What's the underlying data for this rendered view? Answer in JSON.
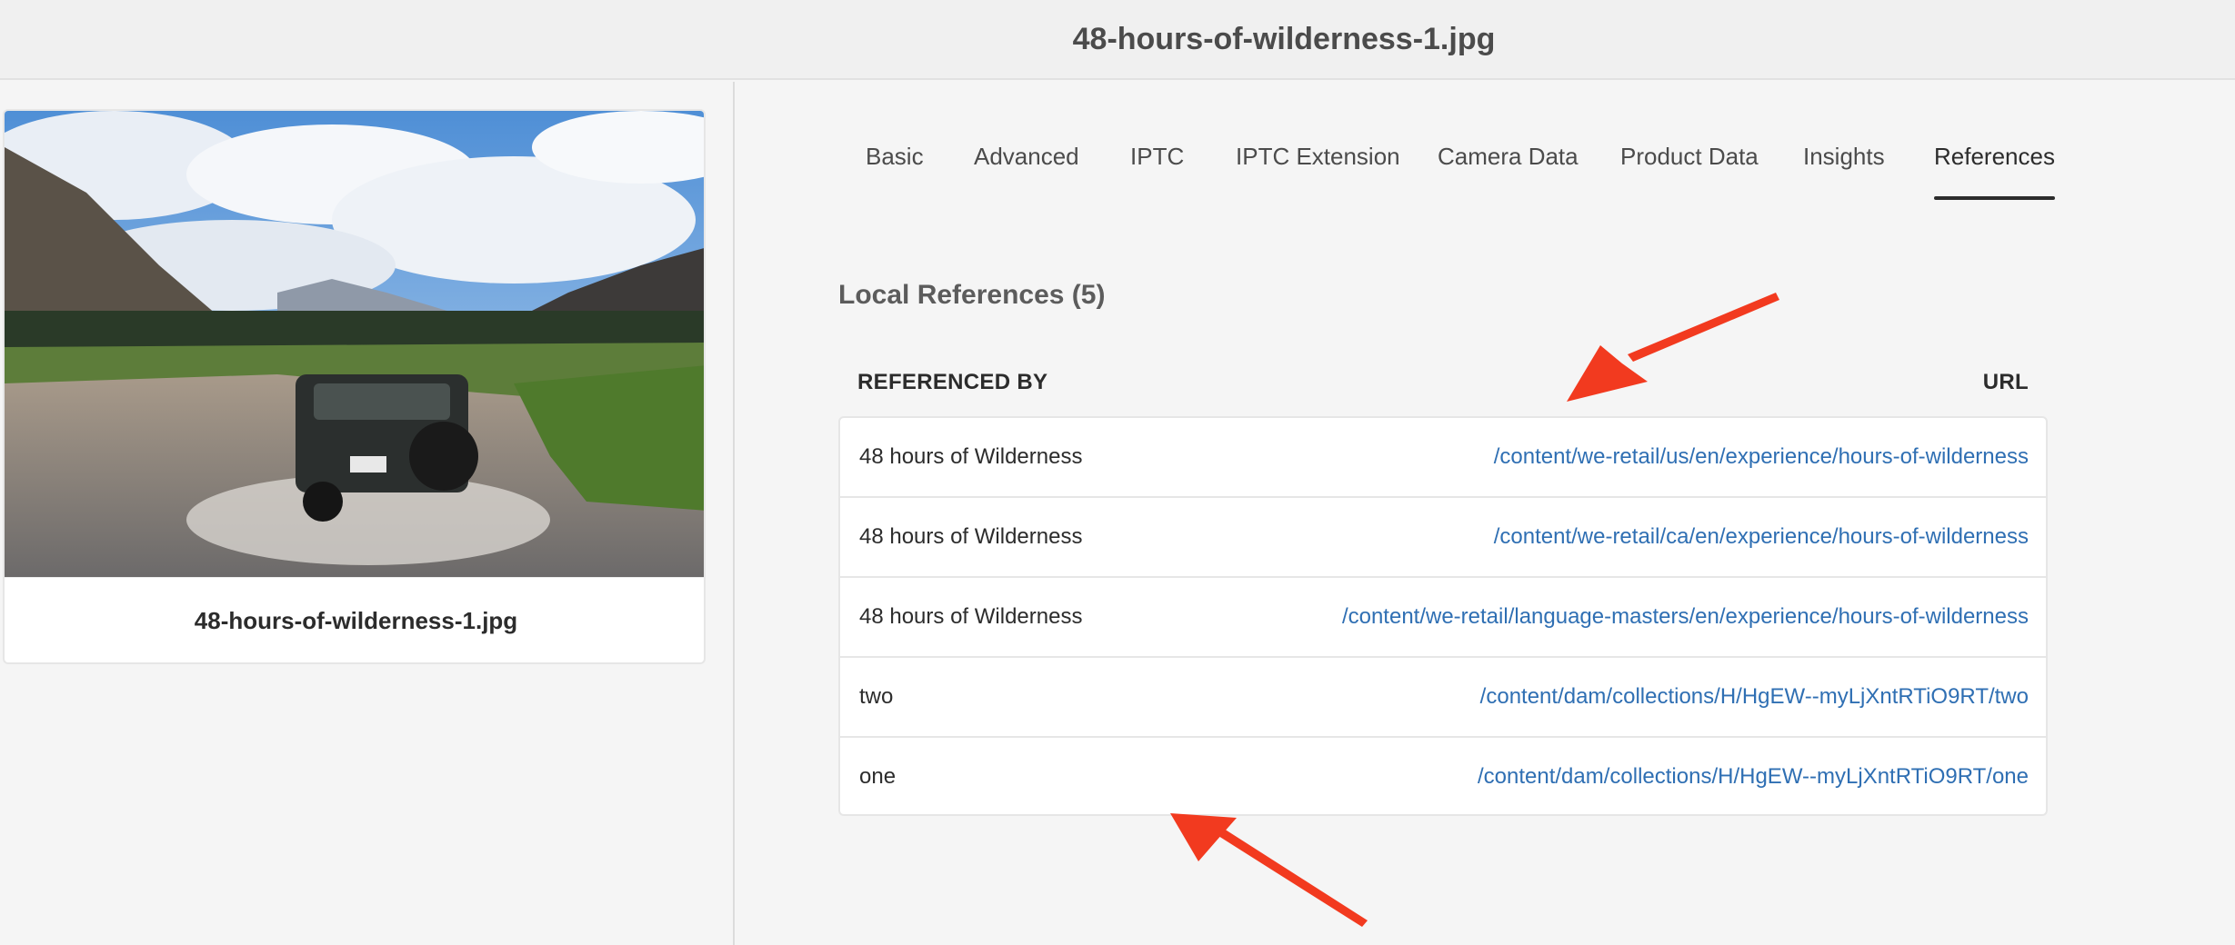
{
  "header": {
    "title": "48-hours-of-wilderness-1.jpg"
  },
  "asset": {
    "name": "48-hours-of-wilderness-1.jpg"
  },
  "tabs": [
    {
      "label": "Basic"
    },
    {
      "label": "Advanced"
    },
    {
      "label": "IPTC"
    },
    {
      "label": "IPTC Extension"
    },
    {
      "label": "Camera Data"
    },
    {
      "label": "Product Data"
    },
    {
      "label": "Insights"
    },
    {
      "label": "References",
      "active": true
    }
  ],
  "references": {
    "title": "Local References (5)",
    "col_referenced_by": "REFERENCED BY",
    "col_url": "URL",
    "rows": [
      {
        "name": "48 hours of Wilderness",
        "url": "/content/we-retail/us/en/experience/hours-of-wilderness"
      },
      {
        "name": "48 hours of Wilderness",
        "url": "/content/we-retail/ca/en/experience/hours-of-wilderness"
      },
      {
        "name": "48 hours of Wilderness",
        "url": "/content/we-retail/language-masters/en/experience/hours-of-wilderness"
      },
      {
        "name": "two",
        "url": "/content/dam/collections/H/HgEW--myLjXntRTiO9RT/two"
      },
      {
        "name": "one",
        "url": "/content/dam/collections/H/HgEW--myLjXntRTiO9RT/one"
      }
    ]
  },
  "colors": {
    "link": "#2f6fb3",
    "annotation_arrow": "#f23a1f",
    "active_tab_underline": "#2c2c2c"
  }
}
